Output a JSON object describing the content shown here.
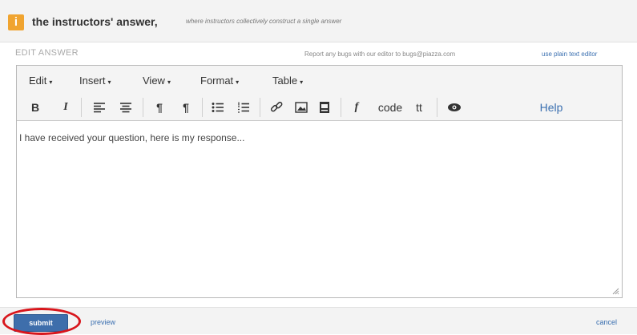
{
  "header": {
    "badge_glyph": "i",
    "title": "the instructors' answer,",
    "subtitle": "where instructors collectively construct a single answer",
    "badge_color": "#f0a430"
  },
  "edit_bar": {
    "label": "EDIT ANSWER",
    "bug_note": "Report any bugs with our editor to bugs@piazza.com",
    "plain_text_link": "use plain text editor"
  },
  "menubar": {
    "items": [
      {
        "label": "Edit",
        "caret": "▾"
      },
      {
        "label": "Insert",
        "caret": "▾"
      },
      {
        "label": "View",
        "caret": "▾"
      },
      {
        "label": "Format",
        "caret": "▾"
      },
      {
        "label": "Table",
        "caret": "▾"
      }
    ]
  },
  "toolbar": {
    "bold": "B",
    "italic": "I",
    "code": "code",
    "tt": "tt",
    "help": "Help",
    "formula": "f",
    "ltr_glyph": "¶",
    "rtl_glyph": "¶"
  },
  "editor": {
    "content": "I have received your question, here is my response..."
  },
  "footer": {
    "submit": "submit",
    "preview": "preview",
    "cancel": "cancel",
    "submit_color": "#3e6eab",
    "highlight_color": "#d8161c"
  }
}
